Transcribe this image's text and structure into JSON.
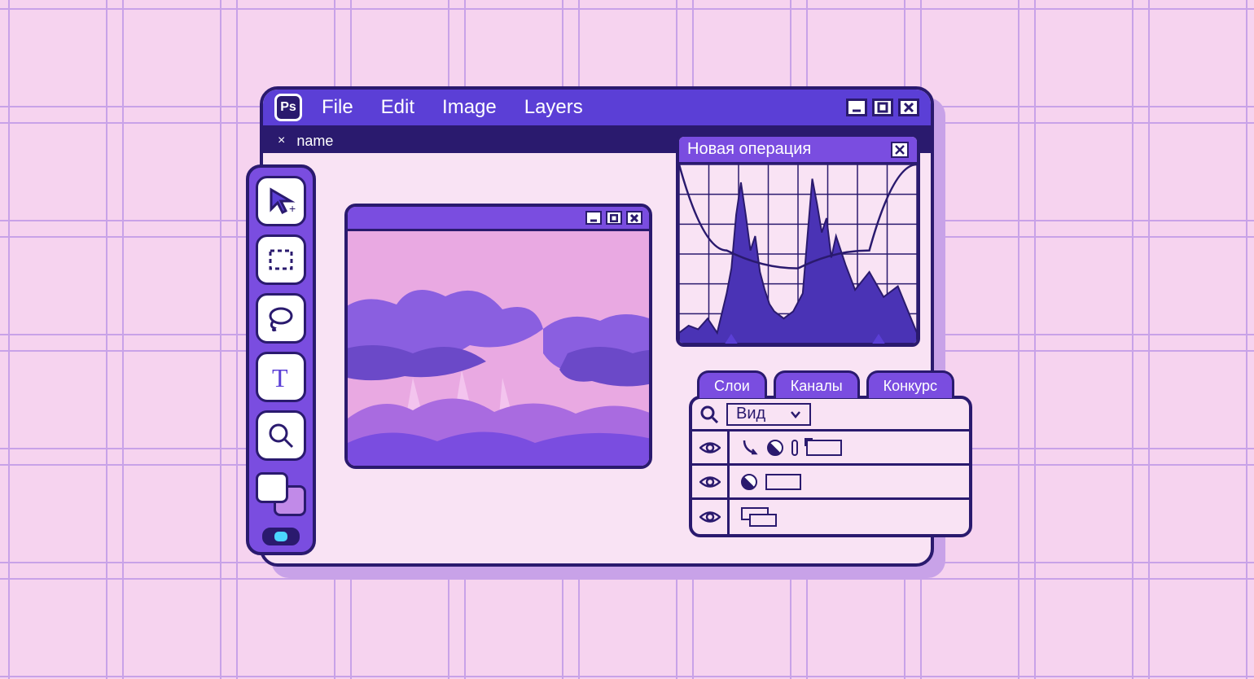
{
  "app": {
    "badge": "Ps",
    "menus": [
      "File",
      "Edit",
      "Image",
      "Layers"
    ],
    "tab_name": "name"
  },
  "tools": [
    {
      "id": "move",
      "name": "move-tool"
    },
    {
      "id": "marquee",
      "name": "marquee-tool"
    },
    {
      "id": "lasso",
      "name": "lasso-tool"
    },
    {
      "id": "text",
      "name": "text-tool"
    },
    {
      "id": "zoom",
      "name": "zoom-tool"
    }
  ],
  "swatch": {
    "fg": "#ffffff",
    "bg": "#c18ae8"
  },
  "histogram_panel": {
    "title": "Новая операция"
  },
  "layers_panel": {
    "tabs": [
      "Слои",
      "Каналы",
      "Конкурс"
    ],
    "view_label": "Вид"
  },
  "colors": {
    "accent": "#5b3fd6",
    "accent_light": "#7a4de0",
    "dark": "#2a1a6e",
    "canvas_bg": "#f9e3f4"
  },
  "chart_data": {
    "type": "area",
    "title": "Новая операция",
    "xlabel": "",
    "ylabel": "",
    "xlim": [
      0,
      100
    ],
    "ylim": [
      0,
      100
    ],
    "grid": true,
    "x": [
      0,
      4,
      8,
      12,
      16,
      20,
      22,
      24,
      26,
      28,
      30,
      32,
      34,
      36,
      38,
      40,
      44,
      48,
      52,
      54,
      56,
      58,
      60,
      62,
      64,
      66,
      70,
      74,
      80,
      86,
      92,
      100
    ],
    "values": [
      6,
      10,
      8,
      14,
      6,
      28,
      42,
      72,
      90,
      72,
      52,
      60,
      40,
      30,
      22,
      18,
      14,
      18,
      28,
      60,
      92,
      78,
      62,
      70,
      48,
      60,
      44,
      30,
      40,
      26,
      32,
      6
    ],
    "curve": {
      "x": [
        0,
        20,
        50,
        80,
        100
      ],
      "y": [
        100,
        52,
        42,
        52,
        100
      ]
    },
    "slider_positions": [
      22,
      84
    ]
  }
}
